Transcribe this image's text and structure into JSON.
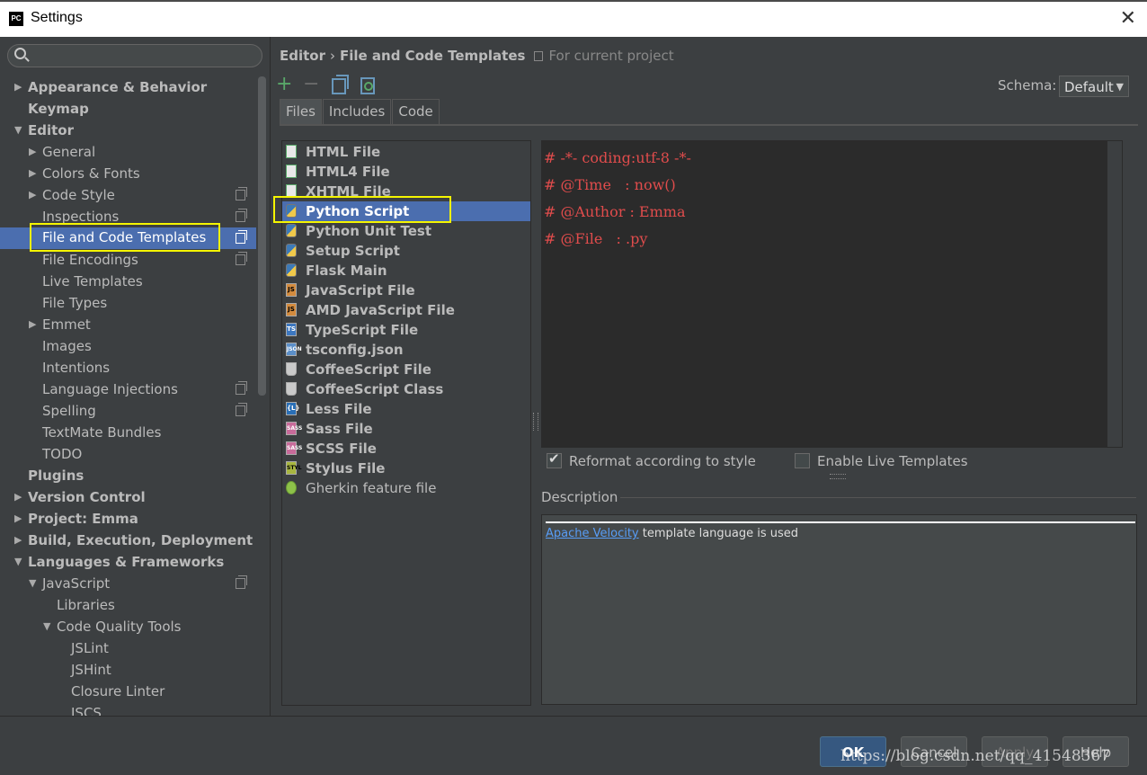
{
  "window": {
    "title": "Settings",
    "app_icon": "PC"
  },
  "tree": [
    {
      "label": "Appearance & Behavior",
      "level": 0,
      "bold": true,
      "arrow": "right"
    },
    {
      "label": "Keymap",
      "level": 0,
      "bold": true,
      "arrow": ""
    },
    {
      "label": "Editor",
      "level": 0,
      "bold": true,
      "arrow": "down"
    },
    {
      "label": "General",
      "level": 1,
      "bold": false,
      "arrow": "right"
    },
    {
      "label": "Colors & Fonts",
      "level": 1,
      "bold": false,
      "arrow": "right"
    },
    {
      "label": "Code Style",
      "level": 1,
      "bold": false,
      "arrow": "right",
      "copy": true
    },
    {
      "label": "Inspections",
      "level": 1,
      "bold": false,
      "arrow": "",
      "copy": true
    },
    {
      "label": "File and Code Templates",
      "level": 1,
      "bold": false,
      "arrow": "",
      "copy": true,
      "selected": true,
      "highlight": true
    },
    {
      "label": "File Encodings",
      "level": 1,
      "bold": false,
      "arrow": "",
      "copy": true
    },
    {
      "label": "Live Templates",
      "level": 1,
      "bold": false,
      "arrow": ""
    },
    {
      "label": "File Types",
      "level": 1,
      "bold": false,
      "arrow": ""
    },
    {
      "label": "Emmet",
      "level": 1,
      "bold": false,
      "arrow": "right"
    },
    {
      "label": "Images",
      "level": 1,
      "bold": false,
      "arrow": ""
    },
    {
      "label": "Intentions",
      "level": 1,
      "bold": false,
      "arrow": ""
    },
    {
      "label": "Language Injections",
      "level": 1,
      "bold": false,
      "arrow": "",
      "copy": true
    },
    {
      "label": "Spelling",
      "level": 1,
      "bold": false,
      "arrow": "",
      "copy": true
    },
    {
      "label": "TextMate Bundles",
      "level": 1,
      "bold": false,
      "arrow": ""
    },
    {
      "label": "TODO",
      "level": 1,
      "bold": false,
      "arrow": ""
    },
    {
      "label": "Plugins",
      "level": 0,
      "bold": true,
      "arrow": ""
    },
    {
      "label": "Version Control",
      "level": 0,
      "bold": true,
      "arrow": "right"
    },
    {
      "label": "Project: Emma",
      "level": 0,
      "bold": true,
      "arrow": "right"
    },
    {
      "label": "Build, Execution, Deployment",
      "level": 0,
      "bold": true,
      "arrow": "right"
    },
    {
      "label": "Languages & Frameworks",
      "level": 0,
      "bold": true,
      "arrow": "down"
    },
    {
      "label": "JavaScript",
      "level": 1,
      "bold": false,
      "arrow": "down",
      "copy": true
    },
    {
      "label": "Libraries",
      "level": 2,
      "bold": false,
      "arrow": ""
    },
    {
      "label": "Code Quality Tools",
      "level": 2,
      "bold": false,
      "arrow": "down"
    },
    {
      "label": "JSLint",
      "level": 3,
      "bold": false,
      "arrow": ""
    },
    {
      "label": "JSHint",
      "level": 3,
      "bold": false,
      "arrow": ""
    },
    {
      "label": "Closure Linter",
      "level": 3,
      "bold": false,
      "arrow": ""
    },
    {
      "label": "JSCS",
      "level": 3,
      "bold": false,
      "arrow": ""
    }
  ],
  "breadcrumb": {
    "part1": "Editor",
    "separator": "›",
    "part2": "File and Code Templates",
    "scope": "For current project"
  },
  "schema": {
    "label": "Schema:",
    "value": "Default"
  },
  "tabs": [
    {
      "label": "Files",
      "active": true
    },
    {
      "label": "Includes",
      "active": false
    },
    {
      "label": "Code",
      "active": false
    }
  ],
  "templates": [
    {
      "label": "HTML File",
      "icon": "html",
      "glyph": ""
    },
    {
      "label": "HTML4 File",
      "icon": "html",
      "glyph": ""
    },
    {
      "label": "XHTML File",
      "icon": "html",
      "glyph": ""
    },
    {
      "label": "Python Script",
      "icon": "py",
      "glyph": "",
      "selected": true,
      "highlight": true
    },
    {
      "label": "Python Unit Test",
      "icon": "py",
      "glyph": ""
    },
    {
      "label": "Setup Script",
      "icon": "py",
      "glyph": ""
    },
    {
      "label": "Flask Main",
      "icon": "py",
      "glyph": ""
    },
    {
      "label": "JavaScript File",
      "icon": "js",
      "glyph": "JS"
    },
    {
      "label": "AMD JavaScript File",
      "icon": "js",
      "glyph": "JS"
    },
    {
      "label": "TypeScript File",
      "icon": "ts",
      "glyph": "TS"
    },
    {
      "label": "tsconfig.json",
      "icon": "json",
      "glyph": "JSON"
    },
    {
      "label": "CoffeeScript File",
      "icon": "coffee",
      "glyph": ""
    },
    {
      "label": "CoffeeScript Class",
      "icon": "coffee",
      "glyph": ""
    },
    {
      "label": "Less File",
      "icon": "less",
      "glyph": "{L}"
    },
    {
      "label": "Sass File",
      "icon": "sass",
      "glyph": "SASS"
    },
    {
      "label": "SCSS File",
      "icon": "sass",
      "glyph": "SASS"
    },
    {
      "label": "Stylus File",
      "icon": "styl",
      "glyph": "STYL"
    },
    {
      "label": "Gherkin feature file",
      "icon": "gherkin",
      "glyph": "",
      "normal": true
    }
  ],
  "code_lines": [
    "# -*- coding:utf-8 -*-",
    "# @Time   : now()",
    "# @Author : Emma",
    "# @File   : .py"
  ],
  "options": {
    "reformat": "Reformat according to style",
    "reformat_checked": true,
    "live": "Enable Live Templates",
    "live_checked": false
  },
  "description": {
    "label": "Description",
    "link": "Apache Velocity",
    "text": " template language is used"
  },
  "buttons": {
    "ok": "OK",
    "cancel": "Cancel",
    "apply": "Apply",
    "help": "Help"
  },
  "watermark": "https://blog.csdn.net/qq_41548367",
  "colors": {
    "selection": "#4b6eaf",
    "highlight": "#f5f500",
    "code": "#e04c4c",
    "link": "#589df6"
  }
}
